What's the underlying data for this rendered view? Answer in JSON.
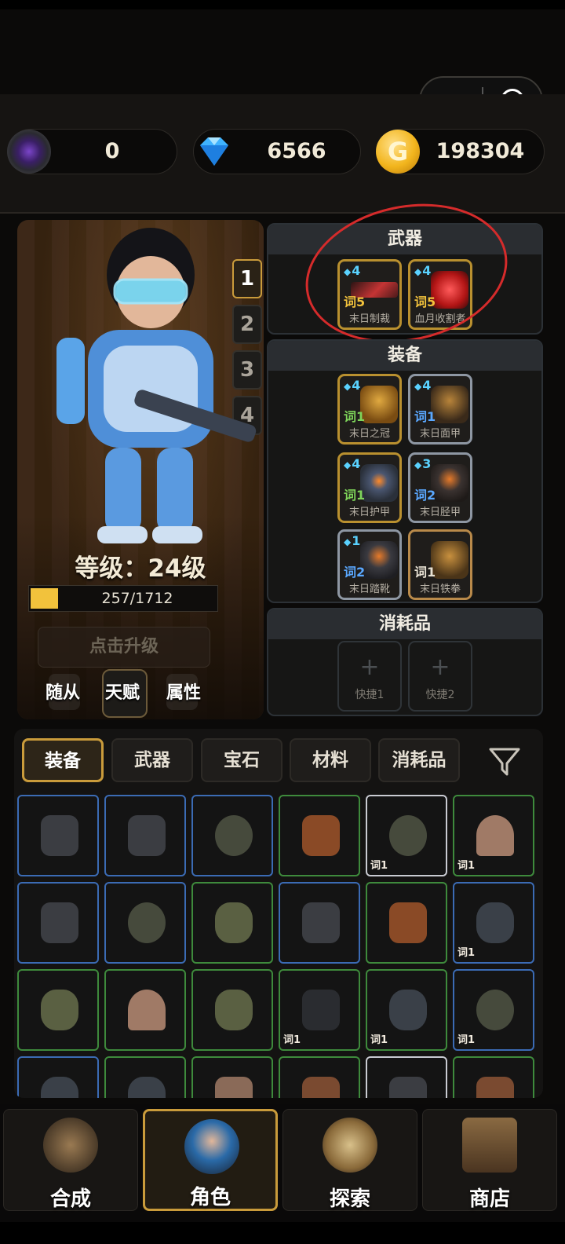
{
  "resources": {
    "dark_crystal": "0",
    "diamond": "6566",
    "gold": "198304",
    "gold_icon_letter": "G"
  },
  "character": {
    "level_text": "等级：24级",
    "xp_text": "257/1712",
    "xp_progress": 0.15,
    "upgrade_label": "点击升级",
    "tabs": [
      "随从",
      "天赋",
      "属性"
    ],
    "loadouts": [
      "1",
      "2",
      "3",
      "4"
    ],
    "active_loadout": "1"
  },
  "weapons": {
    "title": "武器",
    "items": [
      {
        "tier": "4",
        "affix": "词5",
        "name": "末日制裁",
        "affix_color": "#f2c23c"
      },
      {
        "tier": "4",
        "affix": "词5",
        "name": "血月收割者",
        "affix_color": "#f2c23c"
      }
    ]
  },
  "equipment": {
    "title": "装备",
    "items": [
      {
        "tier": "4",
        "affix": "词1",
        "name": "末日之冠",
        "affix_color": "#7ed45a"
      },
      {
        "tier": "4",
        "affix": "词1",
        "name": "末日面甲",
        "affix_color": "#5aa8ff"
      },
      {
        "tier": "4",
        "affix": "词1",
        "name": "末日护甲",
        "affix_color": "#7ed45a"
      },
      {
        "tier": "3",
        "affix": "词2",
        "name": "末日胫甲",
        "affix_color": "#5aa8ff"
      },
      {
        "tier": "1",
        "affix": "词2",
        "name": "末日踏靴",
        "affix_color": "#5aa8ff"
      },
      {
        "tier": "",
        "affix": "词1",
        "name": "末日铁拳",
        "affix_color": "#e8e2d4"
      }
    ]
  },
  "consumables": {
    "title": "消耗品",
    "slots": [
      "快捷1",
      "快捷2"
    ],
    "plus": "+"
  },
  "inventory": {
    "tabs": [
      "装备",
      "武器",
      "宝石",
      "材料",
      "消耗品"
    ],
    "active_tab": "装备",
    "cell_label": "词1"
  },
  "nav": {
    "items": [
      "合成",
      "角色",
      "探索",
      "商店"
    ],
    "active": "角色"
  },
  "colors": {
    "gold_accent": "#c99b3b",
    "rare_blue": "#3b6bb4",
    "uncommon_green": "#3e8a3c",
    "annotation_red": "#d52b2b"
  }
}
